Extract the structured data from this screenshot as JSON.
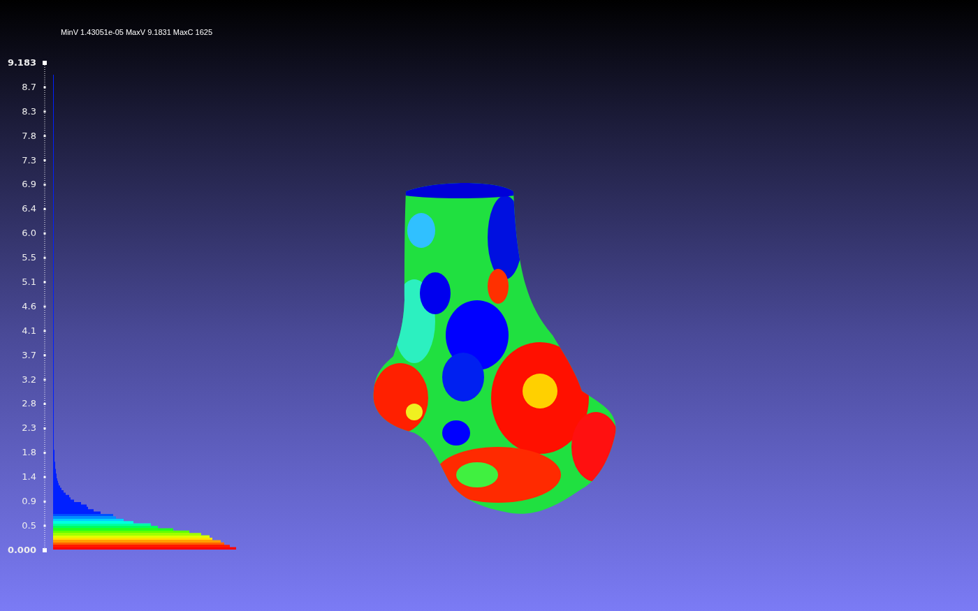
{
  "info_text": "MinV 1.43051e-05 MaxV 9.1831 MaxC 1625",
  "color_scale": {
    "labels": [
      "9.183",
      "8.7",
      "8.3",
      "7.8",
      "7.3",
      "6.9",
      "6.4",
      "6.0",
      "5.5",
      "5.1",
      "4.6",
      "4.1",
      "3.7",
      "3.2",
      "2.8",
      "2.3",
      "1.8",
      "1.4",
      "0.9",
      "0.5",
      "0.000"
    ]
  }
}
